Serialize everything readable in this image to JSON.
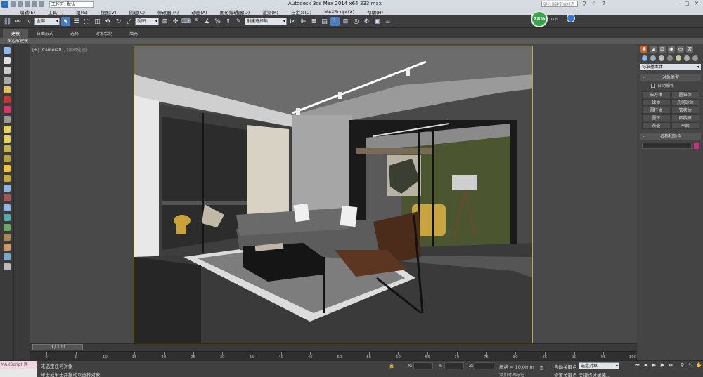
{
  "titlebar": {
    "workspace": "工作区: 默认",
    "title": "Autodesk 3ds Max  2014 x64",
    "file": "333.max",
    "search_placeholder": "键入关键字或短语"
  },
  "menu": [
    "编辑(E)",
    "工具(T)",
    "组(G)",
    "视图(V)",
    "创建(C)",
    "修改器(M)",
    "动画(A)",
    "图形编辑器(D)",
    "渲染(R)",
    "自定义(U)",
    "MAXScript(X)",
    "帮助(H)"
  ],
  "toolbar": {
    "filter": "全部",
    "refcoord": "视图",
    "named_sel": "创建选择集"
  },
  "perf": {
    "percent": "28%",
    "up": "0K/s",
    "down": "0K/s"
  },
  "ribbon": {
    "tabs": [
      "建模",
      "自由形式",
      "选择",
      "对象绘制",
      "填充"
    ],
    "sub": "多边形建模"
  },
  "viewport": {
    "label_left": "[+]",
    "label_cam": "[Camera01]",
    "label_shade": "[明暗处理]"
  },
  "command_panel": {
    "dropdown": "标准基本体",
    "rollout_type": "对象类型",
    "autogrid": "自动栅格",
    "buttons": [
      "长方体",
      "圆锥体",
      "球体",
      "几何球体",
      "圆柱体",
      "管状体",
      "圆环",
      "四棱锥",
      "茶壶",
      "平面"
    ],
    "rollout_name": "名称和颜色",
    "color": "#c0317e"
  },
  "timeline": {
    "slider": "0 / 100",
    "ticks": [
      "0",
      "5",
      "10",
      "15",
      "20",
      "25",
      "30",
      "35",
      "40",
      "45",
      "50",
      "55",
      "60",
      "65",
      "70",
      "75",
      "80",
      "85",
      "90",
      "95",
      "100"
    ]
  },
  "status": {
    "maxscript": "MAXScript 迷",
    "line1": "未选定任何对象",
    "line2": "单击或单击并拖动以选择对象",
    "x": "X:",
    "y": "Y:",
    "z": "Z:",
    "grid": "栅格 = 10.0mm",
    "add_time_tag": "添加时间标记",
    "autokey": "自动关键点",
    "sel_obj": "选定对象",
    "setkey": "设置关键点",
    "key_filter": "关键点过滤器..."
  }
}
